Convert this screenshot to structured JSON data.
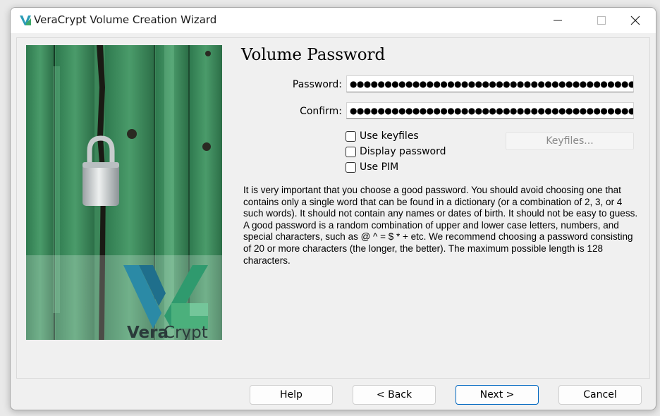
{
  "window": {
    "title": "VeraCrypt Volume Creation Wizard",
    "controls": {
      "minimize": "minimize-icon",
      "maximize": "maximize-icon",
      "close": "close-icon"
    }
  },
  "hero": {
    "brand_part1": "Vera",
    "brand_part2": "Crypt"
  },
  "page": {
    "heading": "Volume Password"
  },
  "form": {
    "password_label": "Password:",
    "password_value": "●●●●●●●●●●●●●●●●●●●●●●●●●●●●●●●●●●●●●●●●●●●●●●●●●●●",
    "confirm_label": "Confirm:",
    "confirm_value": "●●●●●●●●●●●●●●●●●●●●●●●●●●●●●●●●●●●●●●●●●●●●●●●●●●●",
    "options": {
      "use_keyfiles": {
        "label": "Use keyfiles",
        "checked": false
      },
      "display_password": {
        "label": "Display password",
        "checked": false
      },
      "use_pim": {
        "label": "Use PIM",
        "checked": false
      }
    },
    "keyfiles_button": "Keyfiles..."
  },
  "info_text": "It is very important that you choose a good password. You should avoid choosing one that contains only a single word that can be found in a dictionary (or a combination of 2, 3, or 4 such words). It should not contain any names or dates of birth. It should not be easy to guess. A good password is a random combination of upper and lower case letters, numbers, and special characters, such as @ ^ = $ * + etc. We recommend choosing a password consisting of 20 or more characters (the longer, the better). The maximum possible length is 128 characters.",
  "buttons": {
    "help": "Help",
    "back": "< Back",
    "next": "Next >",
    "cancel": "Cancel"
  },
  "colors": {
    "accent": "#0067c0",
    "door_green": "#3d8a5c",
    "logo_teal": "#1f8fa0"
  }
}
